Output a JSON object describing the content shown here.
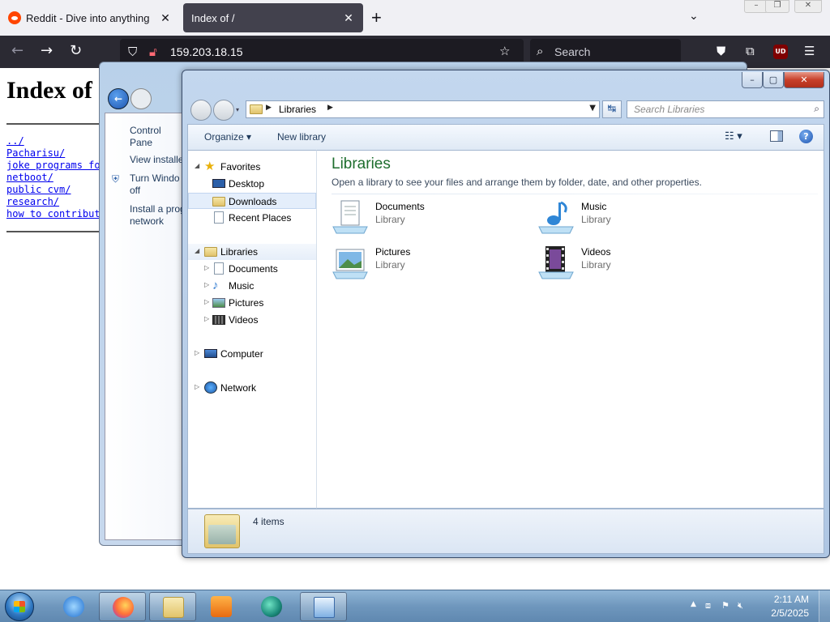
{
  "browser": {
    "tabs": [
      {
        "label": "Reddit - Dive into anything",
        "active": false
      },
      {
        "label": "Index of /",
        "active": true
      }
    ],
    "url": "159.203.18.15",
    "search_placeholder": "Search",
    "new_tab": "+",
    "ublock_label": "UD"
  },
  "web_page": {
    "heading": "Index of",
    "links": [
      "../",
      "Pacharisu/",
      "joke programs fo",
      "netboot/",
      "public cvm/",
      "research/",
      "how to contribute"
    ]
  },
  "control_panel": {
    "links": [
      "Control Pane",
      "View installe",
      "Turn Windo off",
      "Install a prog network"
    ]
  },
  "explorer": {
    "address": {
      "crumb": "Libraries"
    },
    "search_placeholder": "Search Libraries",
    "toolbar": {
      "organize": "Organize ▾",
      "new_library": "New library"
    },
    "nav": {
      "favorites": "Favorites",
      "desktop": "Desktop",
      "downloads": "Downloads",
      "recent": "Recent Places",
      "libraries": "Libraries",
      "documents": "Documents",
      "music": "Music",
      "pictures": "Pictures",
      "videos": "Videos",
      "computer": "Computer",
      "network": "Network"
    },
    "content": {
      "title": "Libraries",
      "description": "Open a library to see your files and arrange them by folder, date, and other properties.",
      "items": [
        {
          "name": "Documents",
          "type": "Library",
          "icon": "documents-library-icon"
        },
        {
          "name": "Music",
          "type": "Library",
          "icon": "music-library-icon"
        },
        {
          "name": "Pictures",
          "type": "Library",
          "icon": "pictures-library-icon"
        },
        {
          "name": "Videos",
          "type": "Library",
          "icon": "videos-library-icon"
        }
      ]
    },
    "status": "4 items"
  },
  "taskbar": {
    "time": "2:11 AM",
    "date": "2/5/2025"
  },
  "colors": {
    "explorer_title_green": "#1e6e2e",
    "firefox_dark": "#2b2a33",
    "link_blue": "#0000ee"
  }
}
